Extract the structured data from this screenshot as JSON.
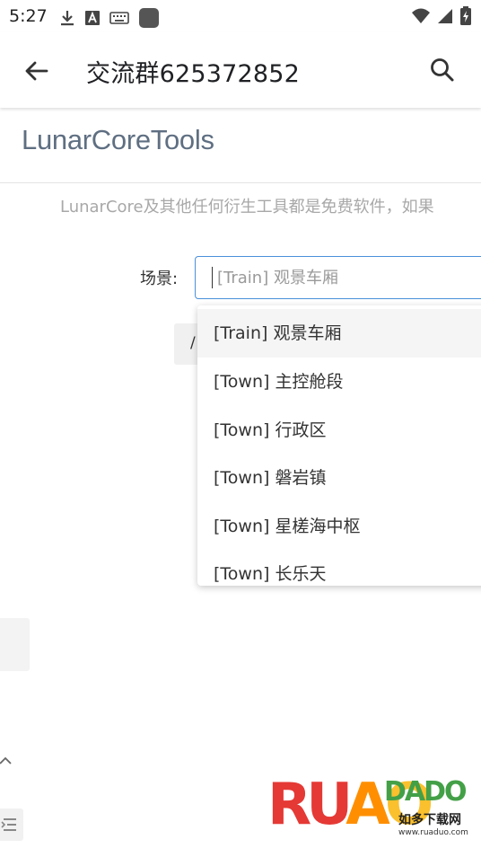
{
  "status_bar": {
    "time": "5:27",
    "left_icons": [
      "download-icon",
      "font-a-icon",
      "keyboard-icon",
      "app-square-icon"
    ],
    "right_icons": [
      "wifi-icon",
      "cellular-signal-icon",
      "battery-charging-icon"
    ]
  },
  "app_bar": {
    "title": "交流群625372852",
    "back_icon": "arrow-left-icon",
    "search_icon": "search-icon"
  },
  "page": {
    "heading": "LunarCoreTools",
    "notice": "LunarCore及其他任何衍生工具都是免费软件，如果"
  },
  "scene": {
    "label": "场景:",
    "placeholder": "[Train] 观景车厢"
  },
  "hidden_button": {
    "label": "/"
  },
  "dropdown": {
    "items": [
      {
        "label": "[Train] 观景车厢"
      },
      {
        "label": "[Town] 主控舱段"
      },
      {
        "label": "[Town] 行政区"
      },
      {
        "label": "[Town] 磐岩镇"
      },
      {
        "label": "[Town] 星槎海中枢"
      },
      {
        "label": "[Town] 长乐天"
      }
    ]
  },
  "watermark": {
    "letters_r": "R",
    "letters_u": "U",
    "letters_a": "A",
    "letters_o": "O",
    "dado": "DADO",
    "cn": "如多下载网",
    "url": "www.ruaduo.com"
  },
  "colors": {
    "accent": "#4a90d9",
    "heading": "#5f6f82"
  }
}
